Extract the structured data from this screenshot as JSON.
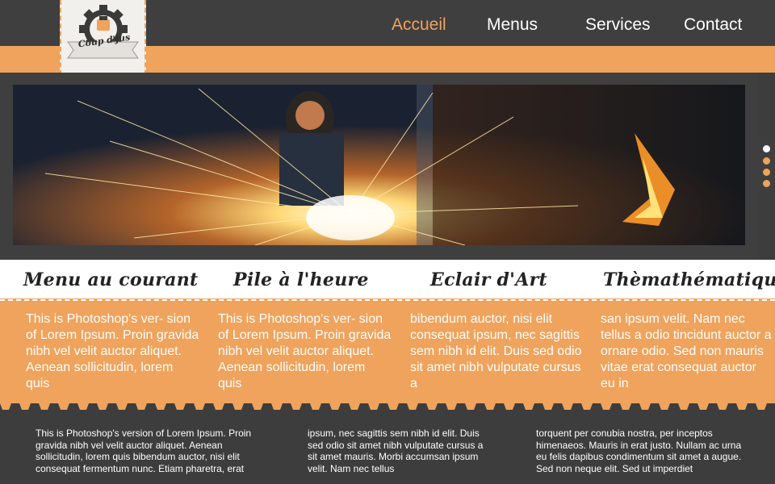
{
  "logo": {
    "text": "Coup d'jus"
  },
  "nav": {
    "items": [
      "Accueil",
      "Menus",
      "Services",
      "Contact"
    ],
    "active": "Accueil"
  },
  "slider": {
    "slide_count": 4,
    "active_index": 0
  },
  "features": [
    {
      "title": "Menu au courant",
      "text": "This is Photoshop's ver- sion of Lorem Ipsum. Proin gravida nibh vel velit auctor aliquet. Aenean sollicitudin, lorem quis"
    },
    {
      "title": "Pile à l'heure",
      "text": "This is Photoshop's ver- sion of Lorem Ipsum. Proin gravida nibh vel velit auctor aliquet. Aenean sollicitudin, lorem quis"
    },
    {
      "title": "Eclair d'Art",
      "text": "bibendum auctor, nisi elit consequat ipsum, nec sagittis sem nibh id elit. Duis sed odio sit amet nibh vulputate cursus a"
    },
    {
      "title": "Thèmathématique",
      "text": "san ipsum velit. Nam nec tellus a odio tincidunt auctor a ornare odio. Sed non mauris vitae erat consequat auctor eu in"
    }
  ],
  "footer": {
    "columns": [
      "This is Photoshop's version of Lorem Ipsum. Proin gravida nibh vel velit auctor aliquet. Aenean sollicitudin, lorem quis bibendum auctor, nisi elit consequat fermentum nunc. Etiam pharetra, erat",
      "ipsum, nec sagittis sem nibh id elit. Duis sed odio sit amet nibh vulputate cursus a sit amet mauris. Morbi accumsan ipsum velit. Nam nec tellus",
      "torquent per conubia nostra, per inceptos himenaeos. Mauris in erat justo. Nullam ac urna eu felis dapibus condimentum sit amet a augue. Sed non neque elit. Sed ut imperdiet"
    ]
  },
  "colors": {
    "accent": "#f0a35c",
    "dark": "#3f3f3f",
    "light": "#ffffff"
  },
  "icons": [
    "gear-logo-icon",
    "coffee-cup-icon"
  ]
}
